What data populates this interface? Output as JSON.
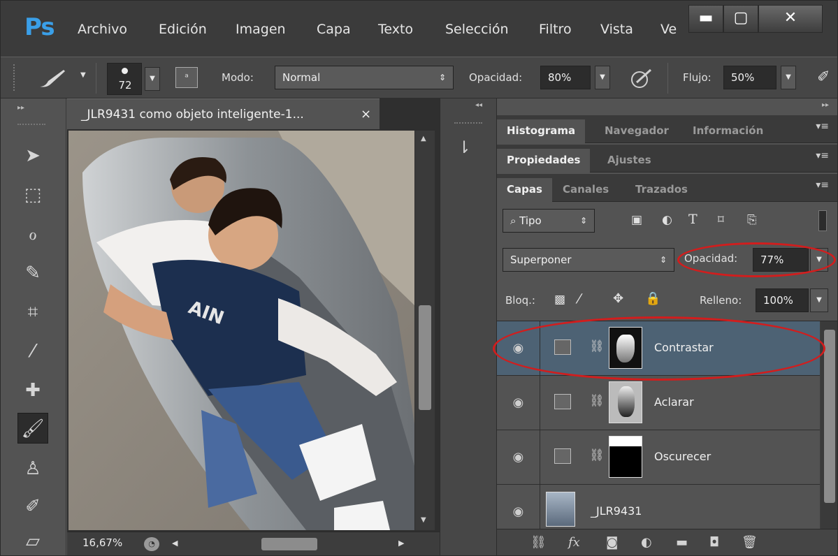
{
  "app": {
    "logo": "Ps"
  },
  "menu": [
    "Archivo",
    "Edición",
    "Imagen",
    "Capa",
    "Texto",
    "Selección",
    "Filtro",
    "Vista",
    "Ve"
  ],
  "window_controls": {
    "minimize": "▬",
    "maximize": "▢",
    "close": "✕"
  },
  "options": {
    "brush_size": "72",
    "mode_label": "Modo:",
    "mode_value": "Normal",
    "opacity_label": "Opacidad:",
    "opacity_value": "80%",
    "flow_label": "Flujo:",
    "flow_value": "50%"
  },
  "document": {
    "tab_title": "_JLR9431 como objeto inteligente-1...",
    "close_glyph": "×",
    "zoom": "16,67%"
  },
  "panels": {
    "group1_tabs": [
      "Histograma",
      "Navegador",
      "Información"
    ],
    "group2_tabs": [
      "Propiedades",
      "Ajustes"
    ],
    "group3_tabs": [
      "Capas",
      "Canales",
      "Trazados"
    ],
    "filter_kind": "Tipo",
    "blend_mode": "Superponer",
    "opacity_label": "Opacidad:",
    "opacity_value": "77%",
    "lock_label": "Bloq.:",
    "fill_label": "Relleno:",
    "fill_value": "100%"
  },
  "layers": [
    {
      "name": "Contrastar",
      "selected": true
    },
    {
      "name": "Aclarar",
      "selected": false
    },
    {
      "name": "Oscurecer",
      "selected": false
    },
    {
      "name": "_JLR9431",
      "selected": false
    }
  ],
  "colors": {
    "accent_selection": "#4d6274",
    "annotation_ring": "#d21d1d",
    "ps_logo": "#3a9fe8"
  },
  "icons": [
    "brush-icon",
    "eye-icon",
    "chain-link-icon",
    "curves-adjustment-icon",
    "lock-icon",
    "trash-icon",
    "new-layer-icon",
    "folder-icon",
    "fx-icon",
    "mask-icon"
  ]
}
